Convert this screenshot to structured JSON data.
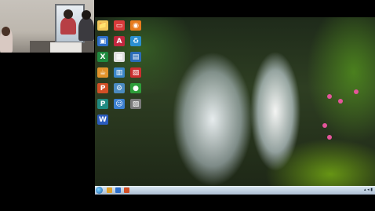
{
  "camera": {},
  "desktop": {
    "icons": [
      {
        "name": "folder",
        "glyph": "📁",
        "color": "#f1c75a"
      },
      {
        "name": "network-icon",
        "glyph": "▭",
        "color": "#d83b3b"
      },
      {
        "name": "browser-icon",
        "glyph": "◉",
        "color": "#e87c1e"
      },
      {
        "name": "computer-icon",
        "glyph": "▣",
        "color": "#2d6fcb"
      },
      {
        "name": "access-icon",
        "glyph": "A",
        "color": "#c2273f"
      },
      {
        "name": "recycle-icon",
        "glyph": "♻",
        "color": "#2b8fd0"
      },
      {
        "name": "excel-icon",
        "glyph": "X",
        "color": "#1f8a3f"
      },
      {
        "name": "app-icon",
        "glyph": "▦",
        "color": "#e0e0e0"
      },
      {
        "name": "store-icon",
        "glyph": "▤",
        "color": "#2c6cb8"
      },
      {
        "name": "java-icon",
        "glyph": "☕",
        "color": "#e2932b"
      },
      {
        "name": "chart-icon",
        "glyph": "▥",
        "color": "#3a86c9"
      },
      {
        "name": "control-icon",
        "glyph": "▧",
        "color": "#cc2f2f"
      },
      {
        "name": "powerpoint-icon",
        "glyph": "P",
        "color": "#d24f26"
      },
      {
        "name": "settings-icon",
        "glyph": "⚙",
        "color": "#4b8bc1"
      },
      {
        "name": "media-icon",
        "glyph": "●",
        "color": "#2e9e3a"
      },
      {
        "name": "publisher-icon",
        "glyph": "P",
        "color": "#1f8b82"
      },
      {
        "name": "users-icon",
        "glyph": "☺",
        "color": "#3b7fcf"
      },
      {
        "name": "tool-icon",
        "glyph": "▨",
        "color": "#7a7a7a"
      },
      {
        "name": "word-icon",
        "glyph": "W",
        "color": "#2b5cbd"
      }
    ]
  },
  "taskbar": {
    "tray_text": "▴ ◂ ▮"
  }
}
